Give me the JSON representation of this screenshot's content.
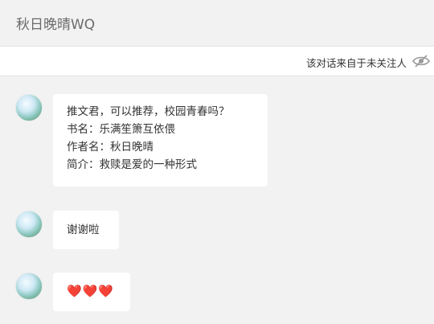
{
  "header": {
    "title": "秋日晚晴WQ"
  },
  "notice": {
    "text": "该对话来自于未关注人",
    "icon": "eye-off-icon"
  },
  "messages": [
    {
      "lines": [
        "推文君，可以推荐，校园青春吗？",
        "书名：乐满笙箫互依偎",
        "作者名：秋日晚晴",
        "简介：救赎是爱的一种形式"
      ]
    },
    {
      "lines": [
        "谢谢啦"
      ]
    },
    {
      "lines": [
        "❤️❤️❤️"
      ]
    }
  ],
  "colors": {
    "background": "#f2f2f2",
    "bubble": "#ffffff",
    "heart": "#e0272b"
  }
}
